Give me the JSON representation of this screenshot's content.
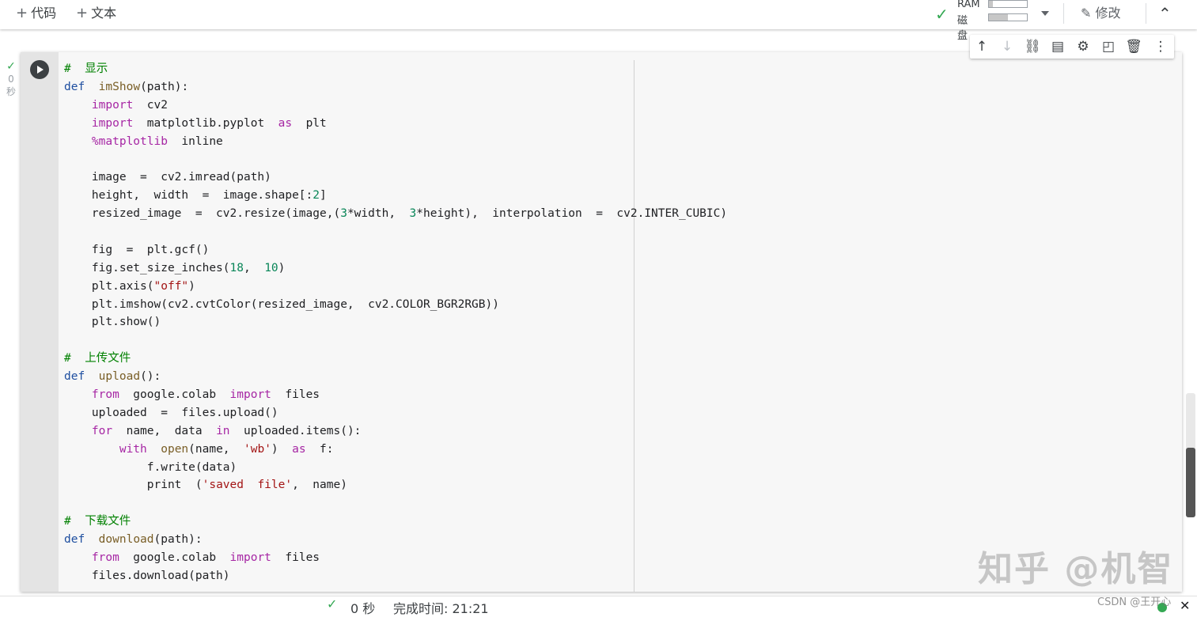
{
  "toolbar": {
    "add_code": "代码",
    "add_text": "文本",
    "ram_label": "RAM",
    "disk_label": "磁盘",
    "ram_usage": 0.1,
    "disk_usage": 0.5,
    "edit_label": "修改"
  },
  "cell_toolbar": {
    "icons": [
      "move-up-icon",
      "move-down-icon",
      "link-icon",
      "comment-icon",
      "settings-icon",
      "mirror-icon",
      "delete-icon",
      "more-icon"
    ]
  },
  "cell": {
    "exec_count": "0",
    "exec_unit": "秒",
    "lines": [
      [
        [
          "cm",
          "#  显示"
        ]
      ],
      [
        [
          "kw",
          "def"
        ],
        [
          "",
          "  "
        ],
        [
          "fn",
          "imShow"
        ],
        [
          "",
          "(path):"
        ]
      ],
      [
        [
          "",
          "    "
        ],
        [
          "mg",
          "import"
        ],
        [
          "",
          "  cv2"
        ]
      ],
      [
        [
          "",
          "    "
        ],
        [
          "mg",
          "import"
        ],
        [
          "",
          "  matplotlib.pyplot  "
        ],
        [
          "mg",
          "as"
        ],
        [
          "",
          "  plt"
        ]
      ],
      [
        [
          "",
          "    "
        ],
        [
          "mg",
          "%matplotlib"
        ],
        [
          "",
          "  inline"
        ]
      ],
      [
        [
          "",
          ""
        ]
      ],
      [
        [
          "",
          "    image  =  cv2.imread(path)"
        ]
      ],
      [
        [
          "",
          "    height,  width  =  image.shape[:"
        ],
        [
          "num",
          "2"
        ],
        [
          "",
          "]"
        ]
      ],
      [
        [
          "",
          "    resized_image  =  cv2.resize(image,("
        ],
        [
          "num",
          "3"
        ],
        [
          "",
          "*width,  "
        ],
        [
          "num",
          "3"
        ],
        [
          "",
          "*height),  interpolation  =  cv2.INTER_CUBIC)"
        ]
      ],
      [
        [
          "",
          ""
        ]
      ],
      [
        [
          "",
          "    fig  =  plt.gcf()"
        ]
      ],
      [
        [
          "",
          "    fig.set_size_inches("
        ],
        [
          "num",
          "18"
        ],
        [
          "",
          ",  "
        ],
        [
          "num",
          "10"
        ],
        [
          "",
          ")"
        ]
      ],
      [
        [
          "",
          "    plt.axis("
        ],
        [
          "str",
          "\"off\""
        ],
        [
          "",
          ")"
        ]
      ],
      [
        [
          "",
          "    plt.imshow(cv2.cvtColor(resized_image,  cv2.COLOR_BGR2RGB))"
        ]
      ],
      [
        [
          "",
          "    plt.show()"
        ]
      ],
      [
        [
          "",
          ""
        ]
      ],
      [
        [
          "cm",
          "#  上传文件"
        ]
      ],
      [
        [
          "kw",
          "def"
        ],
        [
          "",
          "  "
        ],
        [
          "fn",
          "upload"
        ],
        [
          "",
          "():"
        ]
      ],
      [
        [
          "",
          "    "
        ],
        [
          "mg",
          "from"
        ],
        [
          "",
          "  google.colab  "
        ],
        [
          "mg",
          "import"
        ],
        [
          "",
          "  files"
        ]
      ],
      [
        [
          "",
          "    uploaded  =  files.upload()"
        ]
      ],
      [
        [
          "",
          "    "
        ],
        [
          "mg",
          "for"
        ],
        [
          "",
          "  name,  data  "
        ],
        [
          "mg",
          "in"
        ],
        [
          "",
          "  uploaded.items():"
        ]
      ],
      [
        [
          "",
          "        "
        ],
        [
          "mg",
          "with"
        ],
        [
          "",
          "  "
        ],
        [
          "fn",
          "open"
        ],
        [
          "",
          "(name,  "
        ],
        [
          "str",
          "'wb'"
        ],
        [
          "",
          ")  "
        ],
        [
          "mg",
          "as"
        ],
        [
          "",
          "  f:"
        ]
      ],
      [
        [
          "",
          "            f.write(data)"
        ]
      ],
      [
        [
          "",
          "            print  ("
        ],
        [
          "str",
          "'saved  file'"
        ],
        [
          "",
          ",  name)"
        ]
      ],
      [
        [
          "",
          ""
        ]
      ],
      [
        [
          "cm",
          "#  下载文件"
        ]
      ],
      [
        [
          "kw",
          "def"
        ],
        [
          "",
          "  "
        ],
        [
          "fn",
          "download"
        ],
        [
          "",
          "(path):"
        ]
      ],
      [
        [
          "",
          "    "
        ],
        [
          "mg",
          "from"
        ],
        [
          "",
          "  google.colab  "
        ],
        [
          "mg",
          "import"
        ],
        [
          "",
          "  files"
        ]
      ],
      [
        [
          "",
          "    files.download(path)"
        ]
      ]
    ]
  },
  "status": {
    "duration": "0 秒",
    "done_label": "完成时间:  21:21"
  },
  "watermark": "知乎 @机智",
  "csdn": "CSDN @王开心"
}
